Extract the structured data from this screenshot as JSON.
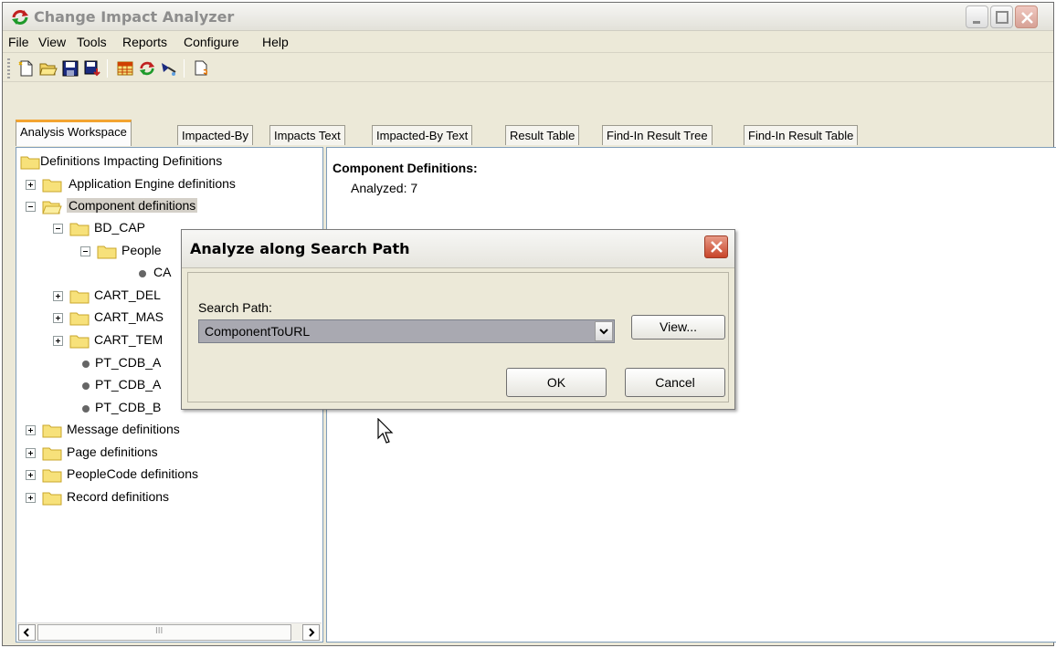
{
  "window": {
    "title": "Change Impact Analyzer"
  },
  "menu": [
    "File",
    "View",
    "Tools",
    "Reports",
    "Configure",
    "Help"
  ],
  "toolbar": {
    "buttons": [
      "new-icon",
      "open-icon",
      "save-icon",
      "save-as-icon",
      "table-icon",
      "refresh-icon",
      "analyze-icon",
      "export-icon"
    ]
  },
  "tabs": [
    "Analysis Workspace",
    "Impacted-By",
    "Impacts Text",
    "Impacted-By Text",
    "Result Table",
    "Find-In Result Tree",
    "Find-In Result Table"
  ],
  "tree": {
    "root": "Definitions Impacting Definitions",
    "items": [
      "Application Engine definitions",
      "Component definitions",
      "BD_CAP",
      "People",
      "CA",
      "CART_DEL",
      "CART_MAS",
      "CART_TEM",
      "PT_CDB_A",
      "PT_CDB_A",
      "PT_CDB_B",
      "Message definitions",
      "Page definitions",
      "PeopleCode definitions",
      "Record definitions"
    ]
  },
  "scrollbar": {
    "thumb_grip": "III"
  },
  "result": {
    "heading": "Component Definitions:",
    "analyzed": "Analyzed: 7"
  },
  "dialog": {
    "title": "Analyze along Search Path",
    "label": "Search Path:",
    "value": "ComponentToURL",
    "view_label": "View...",
    "ok_label": "OK",
    "cancel_label": "Cancel"
  }
}
